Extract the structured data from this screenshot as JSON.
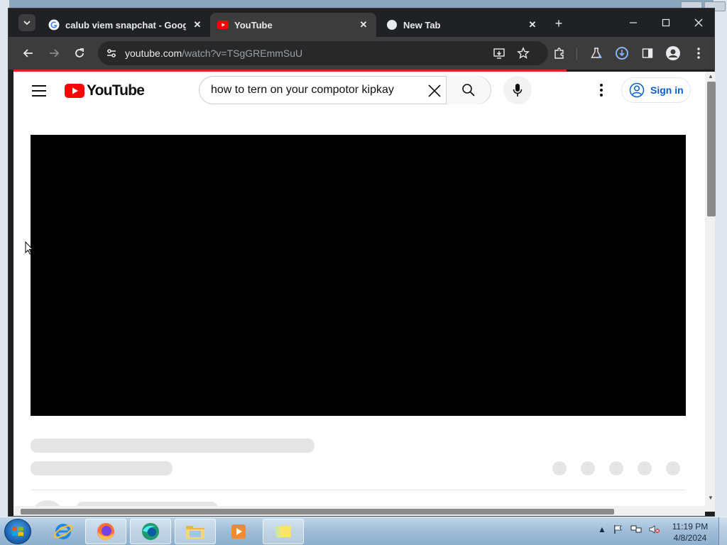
{
  "browser": {
    "tabs": [
      {
        "title": "calub viem snapchat - Google",
        "icon": "google-g-icon",
        "active": false
      },
      {
        "title": "YouTube",
        "icon": "youtube-icon",
        "active": true
      },
      {
        "title": "New Tab",
        "icon": "globe-icon",
        "active": false
      }
    ],
    "url_domain": "youtube.com",
    "url_path": "/watch?v=TSgGREmmSuU",
    "load_progress_percent": 80
  },
  "youtube": {
    "logo_text": "YouTube",
    "search_query": "how to tern on your compotor kipkay",
    "signin_label": "Sign in"
  },
  "taskbar": {
    "time": "11:19 PM",
    "date": "4/8/2024",
    "apps": [
      "internet-explorer-icon",
      "firefox-icon",
      "edge-icon",
      "file-explorer-icon",
      "media-player-icon",
      "sticky-notes-icon"
    ]
  },
  "colors": {
    "youtube_red": "#ff0000",
    "link_blue": "#065fd4",
    "chrome_dark": "#3c3c3c"
  }
}
